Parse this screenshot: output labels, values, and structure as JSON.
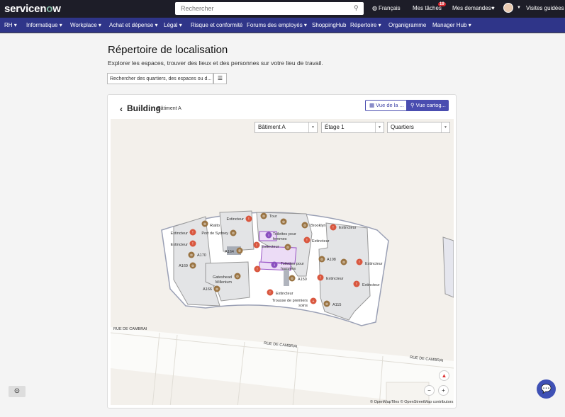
{
  "header": {
    "logo": "servicenow",
    "search_placeholder": "Rechercher",
    "language": "Français",
    "tasks": "Mes tâches",
    "tasks_count": "19",
    "requests": "Mes demandes",
    "tours": "Visites guidées"
  },
  "nav": [
    "RH ▾",
    "Informatique ▾",
    "Workplace ▾",
    "Achat et dépense ▾",
    "Légal ▾",
    "Risque et conformité",
    "Forums des employés ▾",
    "ShoppingHub",
    "Répertoire ▾",
    "Organigramme",
    "Manager Hub ▾"
  ],
  "page": {
    "title": "Répertoire de localisation",
    "subtitle": "Explorer les espaces, trouver des lieux et des personnes sur votre lieu de travail.",
    "search_placeholder": "Rechercher des quartiers, des espaces ou d..."
  },
  "building": {
    "title": "Building",
    "subtitle": "Bâtiment A",
    "view_list": "Vue de la ...",
    "view_map": "Vue cartog..."
  },
  "filters": {
    "building": "Bâtiment A",
    "floor": "Étage 1",
    "layer": "Quartiers"
  },
  "streets": [
    "RUE DE CAMBRAI",
    "RUE DE CAMBRAI",
    "RUE DE CAMBRAI"
  ],
  "markers": [
    {
      "label": "Extincteur",
      "type": "fire"
    },
    {
      "label": "Tour",
      "type": "room"
    },
    {
      "label": "",
      "type": "room"
    },
    {
      "label": "Brooklyn",
      "type": "room"
    },
    {
      "label": "Extincteur",
      "type": "fire"
    },
    {
      "label": "Rialto",
      "type": "room"
    },
    {
      "label": "Port de Sydney",
      "type": "room"
    },
    {
      "label": "Extincteur",
      "type": "fire"
    },
    {
      "label": "Extincteur",
      "type": "fire"
    },
    {
      "label": "Toilettes pour femmes",
      "type": "wc"
    },
    {
      "label": "Extincteur",
      "type": "fire"
    },
    {
      "label": "Extincteur",
      "type": "fire"
    },
    {
      "label": "",
      "type": "room"
    },
    {
      "label": "A170",
      "type": "room"
    },
    {
      "label": "A164",
      "type": "phone"
    },
    {
      "label": "A169",
      "type": "room"
    },
    {
      "label": "Toilettes pour hommes",
      "type": "wc"
    },
    {
      "label": "A108",
      "type": "room"
    },
    {
      "label": "",
      "type": "room"
    },
    {
      "label": "Extincteur",
      "type": "fire"
    },
    {
      "label": "Gateshead Millenium",
      "type": "room"
    },
    {
      "label": "A150",
      "type": "room"
    },
    {
      "label": "Extincteur",
      "type": "fire"
    },
    {
      "label": "Extincteur",
      "type": "fire"
    },
    {
      "label": "A166",
      "type": "room"
    },
    {
      "label": "Extincteur",
      "type": "fire"
    },
    {
      "label": "Trousse de premiers soins",
      "type": "aid"
    },
    {
      "label": "A115",
      "type": "room"
    },
    {
      "label": "",
      "type": "fire"
    }
  ],
  "colors": {
    "fire": "#d9573f",
    "room": "#9a7443",
    "wc": "#8a4fbf",
    "aid": "#d9573f",
    "phone": "#9a7443",
    "accent": "#4a4db0",
    "nav": "#2f3589"
  },
  "attribution": "© OpenMapTiles © OpenStreetMap contributors"
}
